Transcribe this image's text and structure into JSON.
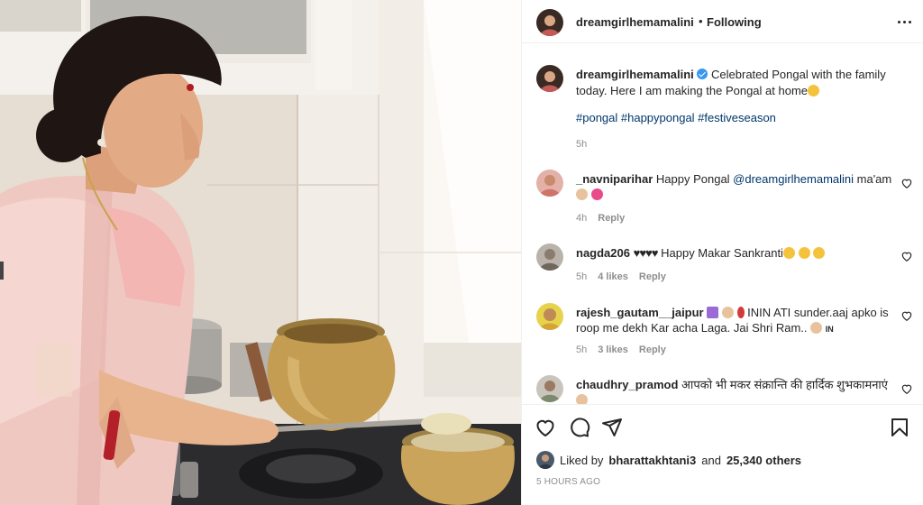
{
  "header": {
    "username": "dreamgirlhemamalini",
    "separator": "•",
    "follow_status": "Following",
    "more_icon": "more-horizontal-icon"
  },
  "caption": {
    "username": "dreamgirlhemamalini",
    "text": "Celebrated Pongal with the family today. Here I am making the Pongal at home",
    "emoji": "smiling-face-emoji",
    "hashtags": "#pongal #happypongal #festiveseason",
    "time": "5h"
  },
  "comments": [
    {
      "username": "_navniparihar",
      "text_pre": "Happy Pongal ",
      "mention": "@dreamgirlhemamalini",
      "text_post": " ma'am",
      "emojis_line2": "praying-hands, two-hearts",
      "time": "4h",
      "likes": "",
      "reply": "Reply"
    },
    {
      "username": "nagda206",
      "text_pre": "Happy Makar Sankranti",
      "emojis_before": "black-hearts x4",
      "emojis_after": "heart-eyes x3",
      "time": "5h",
      "likes": "4 likes",
      "reply": "Reply"
    },
    {
      "username": "rajesh_gautam__jaipur",
      "text_pre": "ININ ATI sunder.aaj apko is roop me dekh Kar acha Laga. Jai Shri Ram..",
      "text_end": "IN",
      "time": "5h",
      "likes": "3 likes",
      "reply": "Reply"
    },
    {
      "username": "chaudhry_pramod",
      "text_pre": "आपको भी मकर संक्रान्ति की हार्दिक शुभकामनाएं"
    }
  ],
  "actions": {
    "like_icon": "heart-icon",
    "comment_icon": "comment-icon",
    "share_icon": "paper-plane-icon",
    "save_icon": "bookmark-icon"
  },
  "likes": {
    "prefix": "Liked by",
    "user": "bharattakhtani3",
    "middle": "and",
    "count": "25,340 others"
  },
  "timestamp": "5 HOURS AGO",
  "colors": {
    "link": "#00376b",
    "meta": "#8e8e8e",
    "text": "#262626",
    "verified": "#3897f0"
  }
}
